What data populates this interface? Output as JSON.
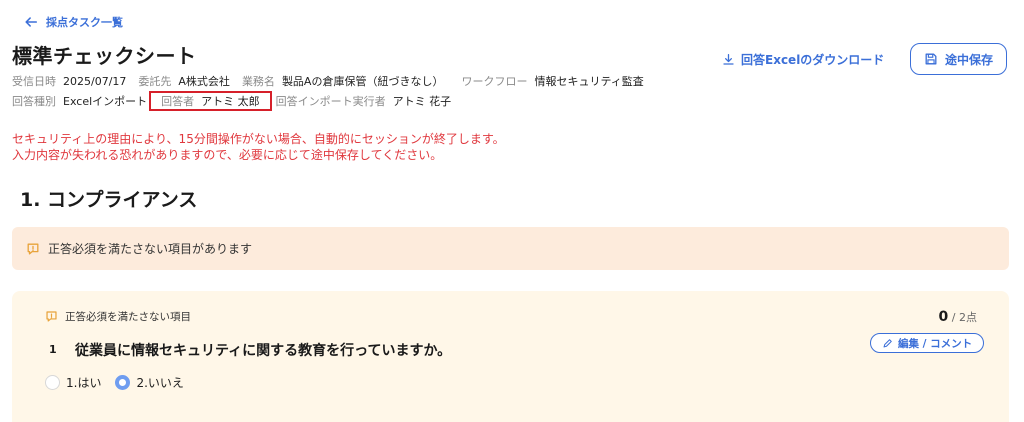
{
  "nav": {
    "back_label": "採点タスク一覧"
  },
  "header": {
    "title": "標準チェックシート",
    "download_label": "回答Excelのダウンロード",
    "save_label": "途中保存"
  },
  "meta": {
    "received_date_label": "受信日時",
    "received_date": "2025/07/17",
    "client_label": "委託先",
    "client": "A株式会社",
    "business_label": "業務名",
    "business": "製品Aの倉庫保管（紐づきなし）",
    "workflow_label": "ワークフロー",
    "workflow": "情報セキュリティ監査",
    "answer_type_label": "回答種別",
    "answer_type": "Excelインポート",
    "respondent_label": "回答者",
    "respondent": "アトミ 太郎",
    "importer_label": "回答インポート実行者",
    "importer": "アトミ 花子"
  },
  "warning": {
    "line1": "セキュリティ上の理由により、15分間操作がない場合、自動的にセッションが終了します。",
    "line2": "入力内容が失われる恐れがありますので、必要に応じて途中保存してください。"
  },
  "section": {
    "title": "1.  コンプライアンス"
  },
  "alert": {
    "text": "正答必須を満たさない項目があります"
  },
  "question": {
    "flag_text": "正答必須を満たさない項目",
    "score_value": "0",
    "score_total": " / 2点",
    "edit_label": "編集 / コメント",
    "number": "1",
    "text": "従業員に情報セキュリティに関する教育を行っていますか。",
    "options": [
      {
        "label": "1.はい",
        "selected": false
      },
      {
        "label": "2.いいえ",
        "selected": true
      }
    ]
  },
  "colors": {
    "accent": "#3b6fd8",
    "warning": "#e0383e",
    "highlight": "#d6202a",
    "alert_bg": "#fdebdc",
    "card_bg": "#fff7e8",
    "alert_icon": "#e8a33a"
  }
}
